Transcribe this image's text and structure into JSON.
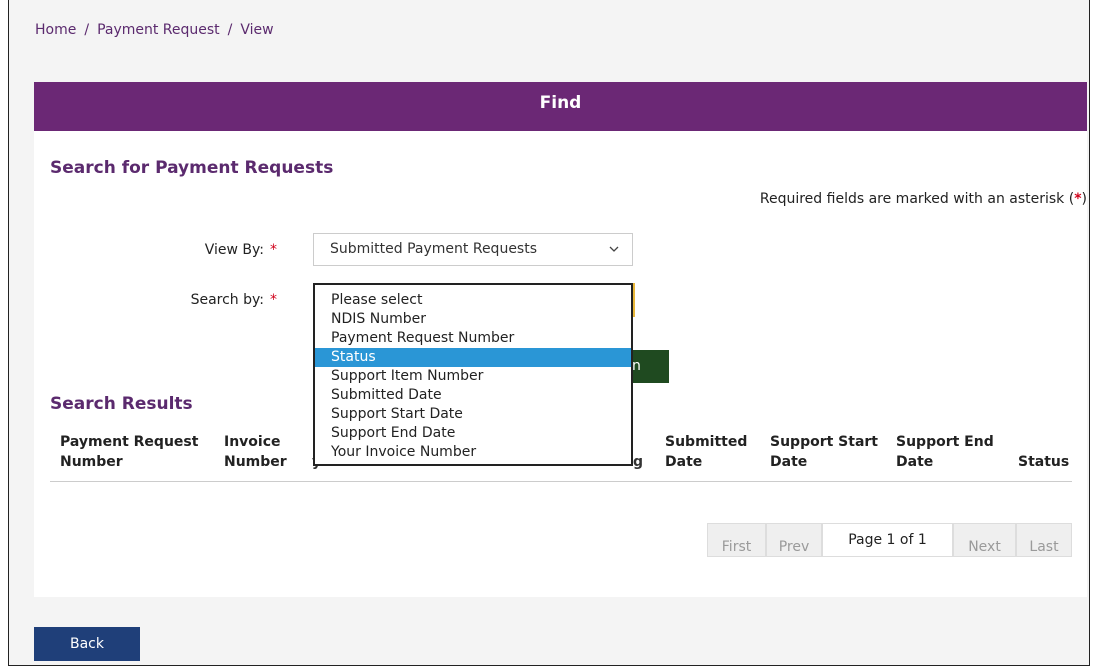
{
  "breadcrumb": {
    "home": "Home",
    "sep1": "/",
    "page": "Payment Request",
    "sep2": "/",
    "current": "View"
  },
  "find_bar": {
    "title": "Find"
  },
  "search": {
    "title": "Search for Payment Requests",
    "required_note_prefix": "Required fields are marked with an asterisk (",
    "required_star": "*",
    "required_note_suffix": ")",
    "view_by_label": "View By:",
    "view_by_value": "Submitted Payment Requests",
    "search_by_label": "Search by:",
    "asterisk": "*",
    "search_by_options": [
      "Please select",
      "NDIS Number",
      "Payment Request Number",
      "Status",
      "Support Item Number",
      "Submitted Date",
      "Support Start Date",
      "Support End Date",
      "Your Invoice Number"
    ],
    "search_by_highlighted": "Status",
    "search_button_label_visible": "n"
  },
  "results": {
    "title": "Search Results",
    "columns": {
      "c1_l1": "Payment Request",
      "c1_l2": "Number",
      "c2_l1": "Invoice",
      "c2_l2": "Number",
      "c3_l2": "y",
      "c4_l2": "g",
      "c5_l1": "Submitted",
      "c5_l2": "Date",
      "c6_l1": "Support Start",
      "c6_l2": "Date",
      "c7_l1": "Support End",
      "c7_l2": "Date",
      "c8": "Status"
    }
  },
  "pager": {
    "first": "First",
    "prev": "Prev",
    "info": "Page 1 of 1",
    "next": "Next",
    "last": "Last"
  },
  "footer": {
    "back_label": "Back"
  },
  "colors": {
    "brand_purple": "#6b2875",
    "selection_blue": "#2a96d6",
    "search_green": "#1f4a20",
    "back_navy": "#1f3f79",
    "required_red": "#d0021b"
  }
}
